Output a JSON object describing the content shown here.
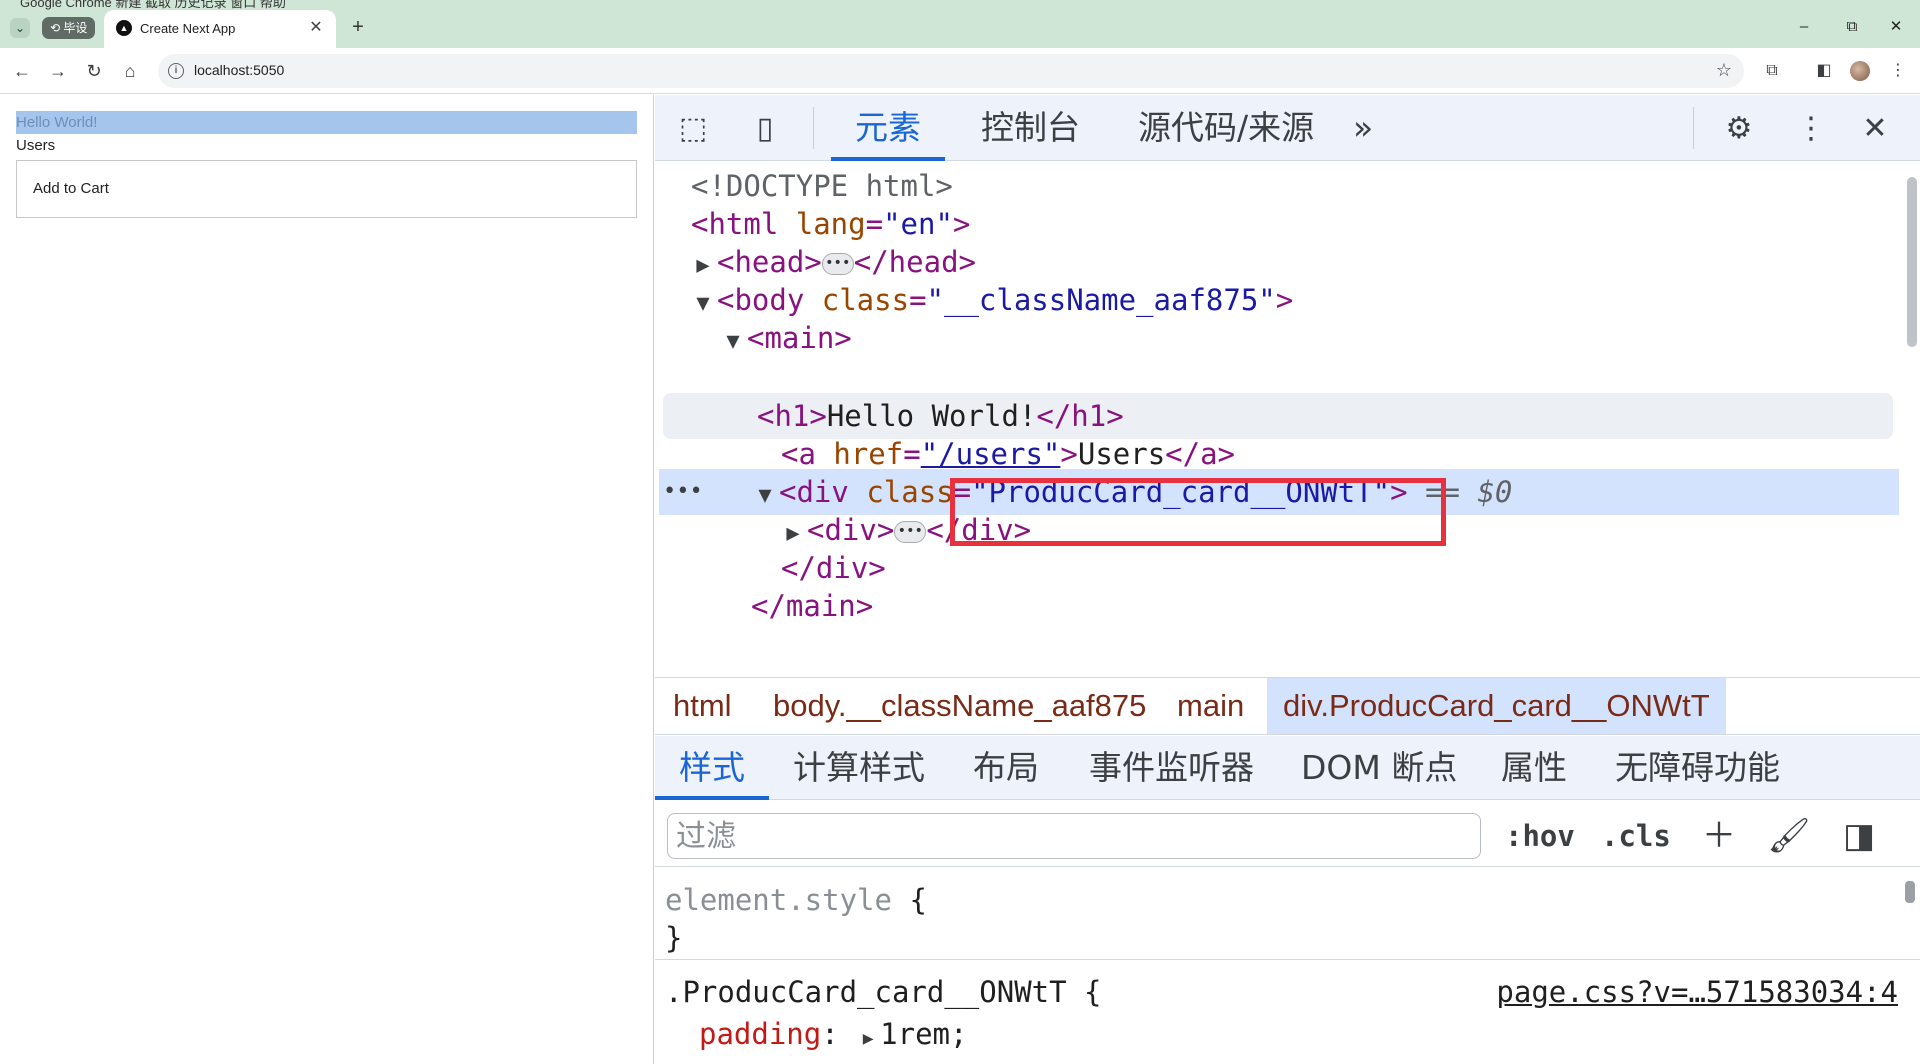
{
  "browser": {
    "menu_text": "Google Chrome   新建    截取    历史记录    窗口    帮助",
    "group_label": "毕设",
    "tab": {
      "title": "Create Next App",
      "close": "✕"
    },
    "new_tab": "+",
    "url": "localhost:5050",
    "window": {
      "minimize": "–",
      "restore": "⧉",
      "close": "✕"
    }
  },
  "page": {
    "heading": "Hello World!",
    "users_link": "Users",
    "card_text": "Add to Cart"
  },
  "devtools": {
    "tabs": [
      "元素",
      "控制台",
      "源代码/来源"
    ],
    "more": "»",
    "dom": {
      "doctype": "<!DOCTYPE html>",
      "html_open": {
        "tag": "<html ",
        "attr": "lang",
        "val": "\"en\"",
        "close": ">"
      },
      "head": {
        "open": "<head>",
        "close": "</head>"
      },
      "body": {
        "tag": "<body ",
        "attr": "class",
        "val": "\"__className_aaf875\"",
        "close": ">"
      },
      "main_open": "<main>",
      "h1": {
        "open": "<h1>",
        "text": "Hello World!",
        "close": "</h1>"
      },
      "a": {
        "tag": "<a ",
        "attr": "href",
        "val": "\"/users\"",
        "open_end": ">",
        "text": "Users",
        "close": "</a>"
      },
      "div": {
        "tag": "<div ",
        "attr": "class",
        "val": "\"ProducCard_card__ONWtT\"",
        "close": ">",
        "marker": "== $0"
      },
      "inner_div": {
        "open": "<div>",
        "close": "</div>"
      },
      "div_close": "</div>",
      "main_close": "</main>"
    },
    "breadcrumbs": [
      "html",
      "body.__className_aaf875",
      "main",
      "div.ProducCard_card__ONWtT"
    ],
    "subtabs": [
      "样式",
      "计算样式",
      "布局",
      "事件监听器",
      "DOM 断点",
      "属性",
      "无障碍功能"
    ],
    "filter": {
      "placeholder": "过滤",
      "hov": ":hov",
      "cls": ".cls"
    },
    "styles": {
      "element_style": "element.style",
      "open_brace": "{",
      "close_brace": "}",
      "rule_selector": ".ProducCard_card__ONWtT",
      "source": "page.css?v=…571583034:4",
      "prop": "padding",
      "colon": ":",
      "value": "1rem;"
    }
  },
  "colors": {
    "accent": "#1a66d2",
    "highlight_box": "#e8313f",
    "selected_row": "#d3e3fd",
    "tab_strip": "#cfe5d6"
  }
}
